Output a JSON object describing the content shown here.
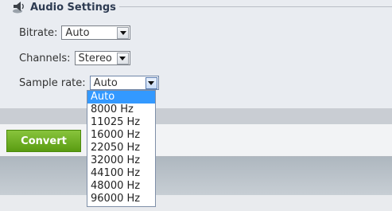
{
  "section": {
    "title": "Audio Settings",
    "icon": "speaker-icon"
  },
  "bitrate": {
    "label": "Bitrate:",
    "value": "Auto"
  },
  "channels": {
    "label": "Channels:",
    "value": "Stereo"
  },
  "sample_rate": {
    "label": "Sample rate:",
    "value": "Auto",
    "options": [
      "Auto",
      "8000 Hz",
      "11025 Hz",
      "16000 Hz",
      "22050 Hz",
      "32000 Hz",
      "44100 Hz",
      "48000 Hz",
      "96000 Hz"
    ],
    "highlighted_index": 0
  },
  "actions": {
    "convert_label": "Convert"
  },
  "colors": {
    "accent_green": "#6aaa1f",
    "highlight_blue": "#3399ff",
    "title_color": "#2d3b52"
  }
}
